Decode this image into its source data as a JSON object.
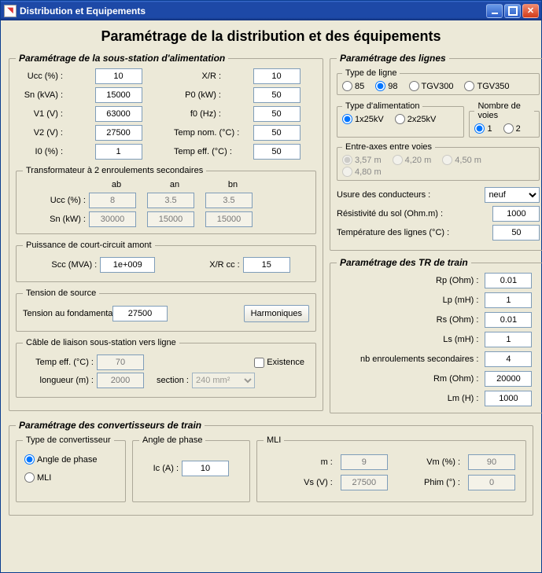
{
  "window": {
    "title": "Distribution et Equipements"
  },
  "main_title": "Paramétrage de la distribution et des équipements",
  "substation": {
    "legend": "Paramétrage de la sous-station d'alimentation",
    "ucc_label": "Ucc (%) :",
    "ucc": "10",
    "xr_label": "X/R :",
    "xr": "10",
    "sn_label": "Sn (kVA) :",
    "sn": "15000",
    "p0_label": "P0 (kW) :",
    "p0": "50",
    "v1_label": "V1 (V) :",
    "v1": "63000",
    "f0_label": "f0 (Hz) :",
    "f0": "50",
    "v2_label": "V2 (V) :",
    "v2": "27500",
    "tnom_label": "Temp nom. (°C) :",
    "tnom": "50",
    "i0_label": "I0 (%) :",
    "i0": "1",
    "teff_label": "Temp eff. (°C) :",
    "teff": "50",
    "transfo2": {
      "legend": "Transformateur à 2 enroulements secondaires",
      "col_ab": "ab",
      "col_an": "an",
      "col_bn": "bn",
      "ucc_label": "Ucc (%) :",
      "ucc_ab": "8",
      "ucc_an": "3.5",
      "ucc_bn": "3.5",
      "sn_label": "Sn (kW) :",
      "sn_ab": "30000",
      "sn_an": "15000",
      "sn_bn": "15000"
    },
    "pcc": {
      "legend": "Puissance de court-circuit amont",
      "scc_label": "Scc (MVA) :",
      "scc": "1e+009",
      "xrcc_label": "X/R cc :",
      "xrcc": "15"
    },
    "vsrc": {
      "legend": "Tension de source",
      "vf_label": "Tension au fondamental (V) :",
      "vf": "27500",
      "harmo_btn": "Harmoniques"
    },
    "cable": {
      "legend": "Câble de liaison sous-station vers ligne",
      "teff_label": "Temp eff. (°C) :",
      "teff": "70",
      "exist_label": "Existence",
      "long_label": "longueur (m) :",
      "long": "2000",
      "sect_label": "section :",
      "sect": "240 mm²"
    }
  },
  "lignes": {
    "legend": "Paramétrage des lignes",
    "type_ligne": {
      "legend": "Type de ligne",
      "opt1": "85",
      "opt2": "98",
      "opt3": "TGV300",
      "opt4": "TGV350",
      "selected": "98"
    },
    "type_alim": {
      "legend": "Type d'alimentation",
      "opt1": "1x25kV",
      "opt2": "2x25kV",
      "selected": "1x25kV"
    },
    "nb_voies": {
      "legend": "Nombre de voies",
      "opt1": "1",
      "opt2": "2",
      "selected": "1"
    },
    "entre_axes": {
      "legend": "Entre-axes entre voies",
      "opt1": "3,57 m",
      "opt2": "4,20 m",
      "opt3": "4,50 m",
      "opt4": "4,80 m"
    },
    "usure_label": "Usure des conducteurs :",
    "usure": "neuf",
    "resist_label": "Résistivité du sol (Ohm.m) :",
    "resist": "1000",
    "temp_label": "Température des lignes  (°C) :",
    "temp": "50"
  },
  "tr_train": {
    "legend": "Paramétrage des TR de train",
    "rp_label": "Rp (Ohm) :",
    "rp": "0.01",
    "lp_label": "Lp (mH) :",
    "lp": "1",
    "rs_label": "Rs (Ohm) :",
    "rs": "0.01",
    "ls_label": "Ls (mH) :",
    "ls": "1",
    "nbe_label": "nb enroulements secondaires :",
    "nbe": "4",
    "rm_label": "Rm (Ohm) :",
    "rm": "20000",
    "lm_label": "Lm (H) :",
    "lm": "1000"
  },
  "conv": {
    "legend": "Paramétrage des convertisseurs de train",
    "type": {
      "legend": "Type de convertisseur",
      "opt1": "Angle de phase",
      "opt2": "MLI",
      "selected": "Angle de phase"
    },
    "angle": {
      "legend": "Angle de phase",
      "ic_label": "Ic (A) :",
      "ic": "10"
    },
    "mli": {
      "legend": "MLI",
      "m_label": "m :",
      "m": "9",
      "vm_label": "Vm (%) :",
      "vm": "90",
      "vs_label": "Vs (V) :",
      "vs": "27500",
      "phim_label": "Phim (°) :",
      "phim": "0"
    }
  }
}
